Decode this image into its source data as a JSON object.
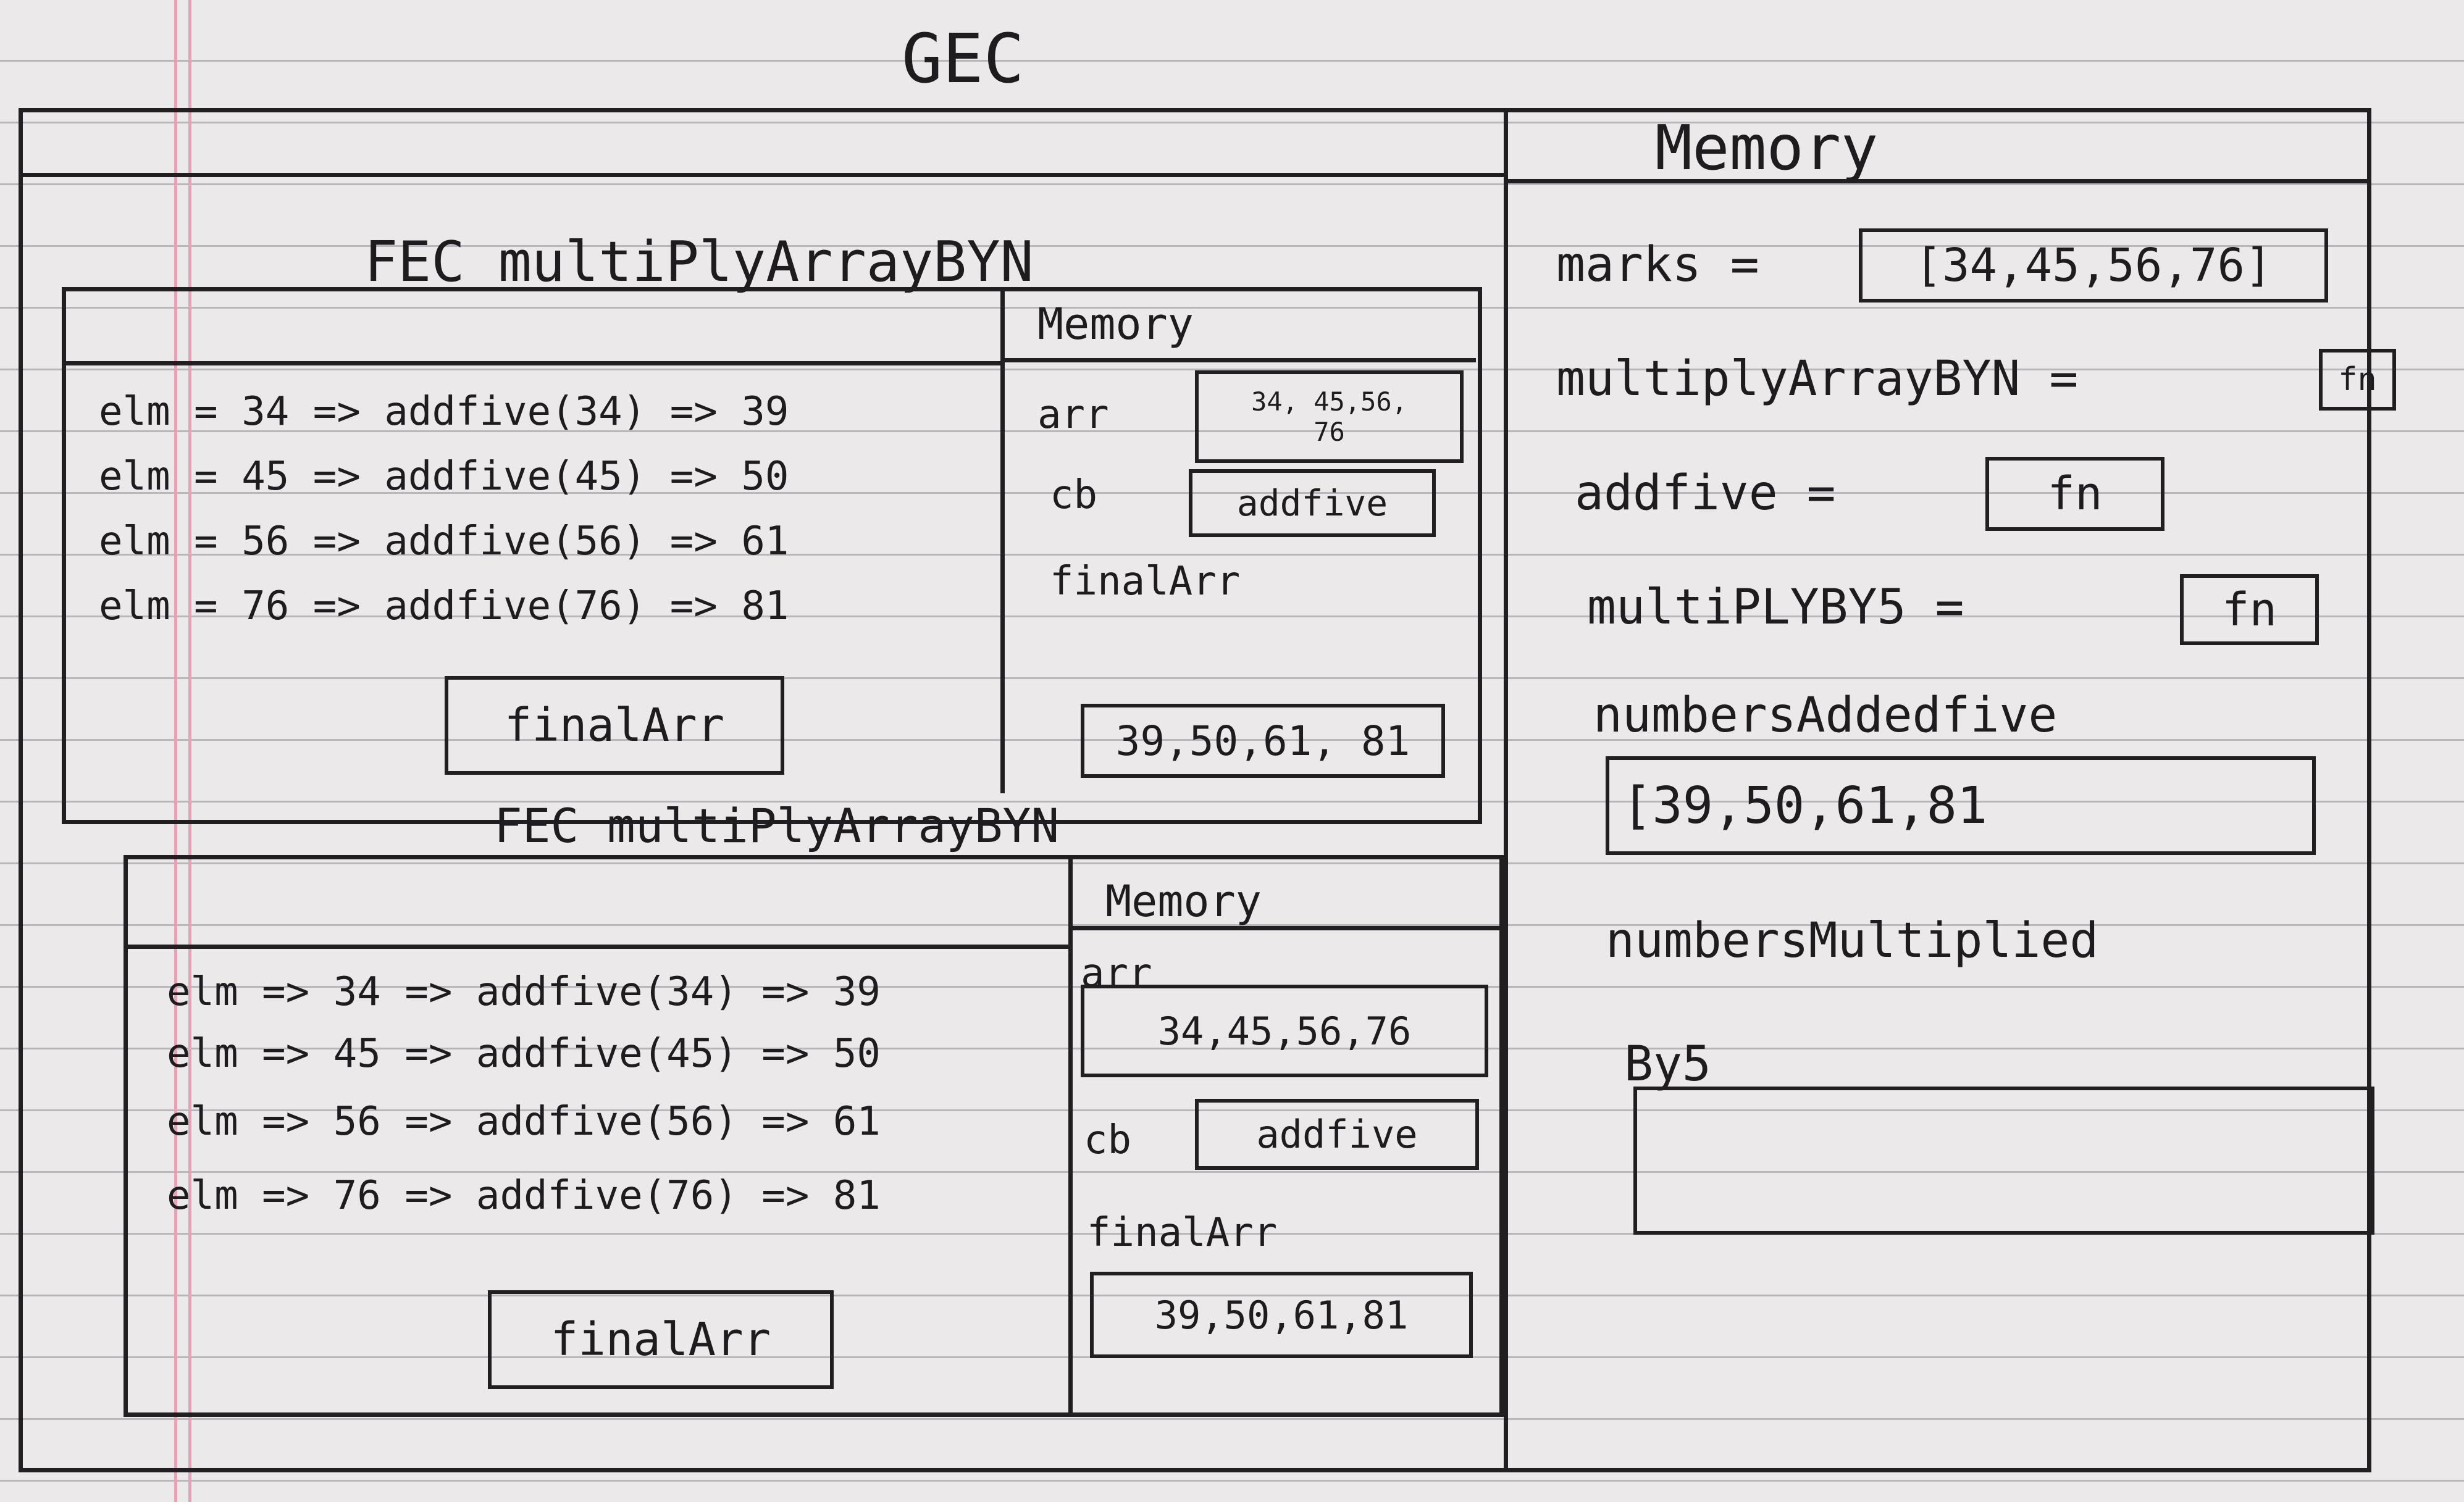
{
  "gec": {
    "title": "GEC"
  },
  "global_memory": {
    "title": "Memory",
    "marks_label": "marks =",
    "marks_value": "[34,45,56,76]",
    "multiply_label": "multiplyArrayBYN =",
    "multiply_value": "fn",
    "addfive_label": "addfive =",
    "addfive_value": "fn",
    "multiplyby5_label": "multiPLYBY5 =",
    "multiplyby5_value": "fn",
    "added_label": "numbersAddedfive",
    "added_value": "[39,50,61,81",
    "multiplied_label_1": "numbersMultiplied",
    "multiplied_label_2": "By5",
    "multiplied_value": ""
  },
  "fec1": {
    "title": "FEC multiPlyArrayBYN",
    "rows": [
      "elm = 34 => addfive(34) => 39",
      "elm = 45 => addfive(45) => 50",
      "elm = 56 => addfive(56) => 61",
      "elm = 76 => addfive(76) => 81"
    ],
    "return_box": "finalArr",
    "memory": {
      "title": "Memory",
      "arr_label": "arr",
      "arr_value_line1": "34, 45,56,",
      "arr_value_line2": "76",
      "cb_label": "cb",
      "cb_value": "addfive",
      "final_label": "finalArr",
      "final_value": "39,50,61, 81"
    }
  },
  "fec2": {
    "title": "FEC multiPlyArrayBYN",
    "rows": [
      "elm => 34 => addfive(34) => 39",
      "elm => 45 => addfive(45) => 50",
      "elm => 56 => addfive(56) => 61",
      "elm => 76 => addfive(76) => 81"
    ],
    "return_box": "finalArr",
    "memory": {
      "title": "Memory",
      "arr_label": "arr",
      "arr_value": "34,45,56,76",
      "cb_label": "cb",
      "cb_value": "addfive",
      "final_label": "finalArr",
      "final_value": "39,50,61,81"
    }
  }
}
